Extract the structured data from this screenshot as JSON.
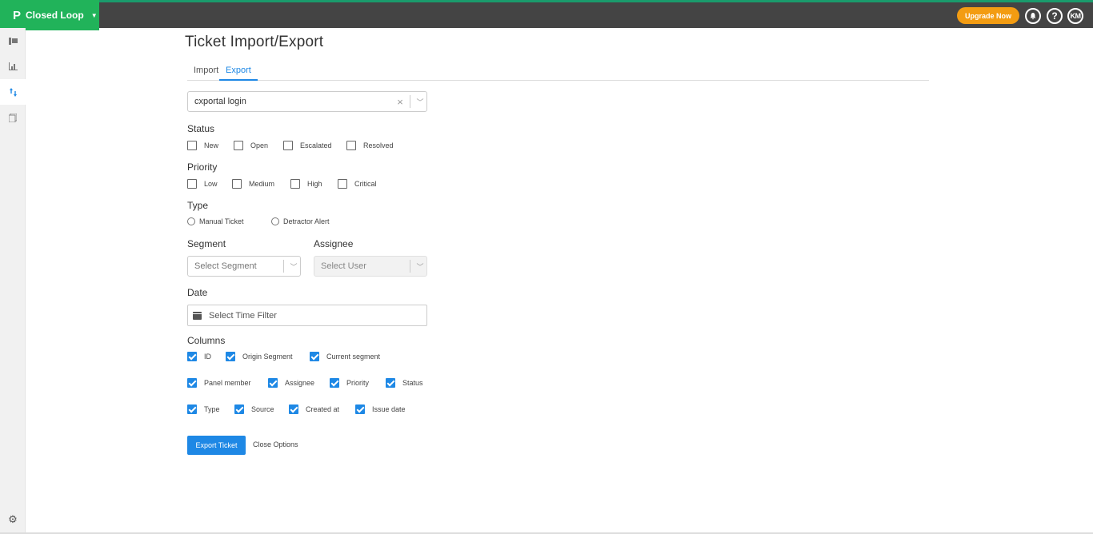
{
  "topbar": {
    "brand_label": "Closed Loop",
    "upgrade_label": "Upgrade Now",
    "help_label": "?",
    "avatar_initials": "KM"
  },
  "page": {
    "title": "Ticket Import/Export",
    "tabs": [
      "Import",
      "Export"
    ],
    "active_tab": "Export"
  },
  "form": {
    "survey_value": "cxportal login",
    "status_label": "Status",
    "status_options": [
      "New",
      "Open",
      "Escalated",
      "Resolved"
    ],
    "priority_label": "Priority",
    "priority_options": [
      "Low",
      "Medium",
      "High",
      "Critical"
    ],
    "type_label": "Type",
    "type_options": [
      "Manual Ticket",
      "Detractor Alert"
    ],
    "segment_label": "Segment",
    "segment_placeholder": "Select Segment",
    "assignee_label": "Assignee",
    "assignee_placeholder": "Select User",
    "date_label": "Date",
    "date_placeholder": "Select Time Filter",
    "columns_label": "Columns",
    "columns": [
      "ID",
      "Origin Segment",
      "Current segment",
      "Panel member",
      "Assignee",
      "Priority",
      "Status",
      "Type",
      "Source",
      "Created at",
      "Issue date"
    ],
    "export_button": "Export Ticket",
    "close_link": "Close Options"
  },
  "colors": {
    "brand": "#21b35a",
    "accent": "#1e88e5",
    "upgrade": "#f39c12",
    "topbar": "#444444"
  }
}
